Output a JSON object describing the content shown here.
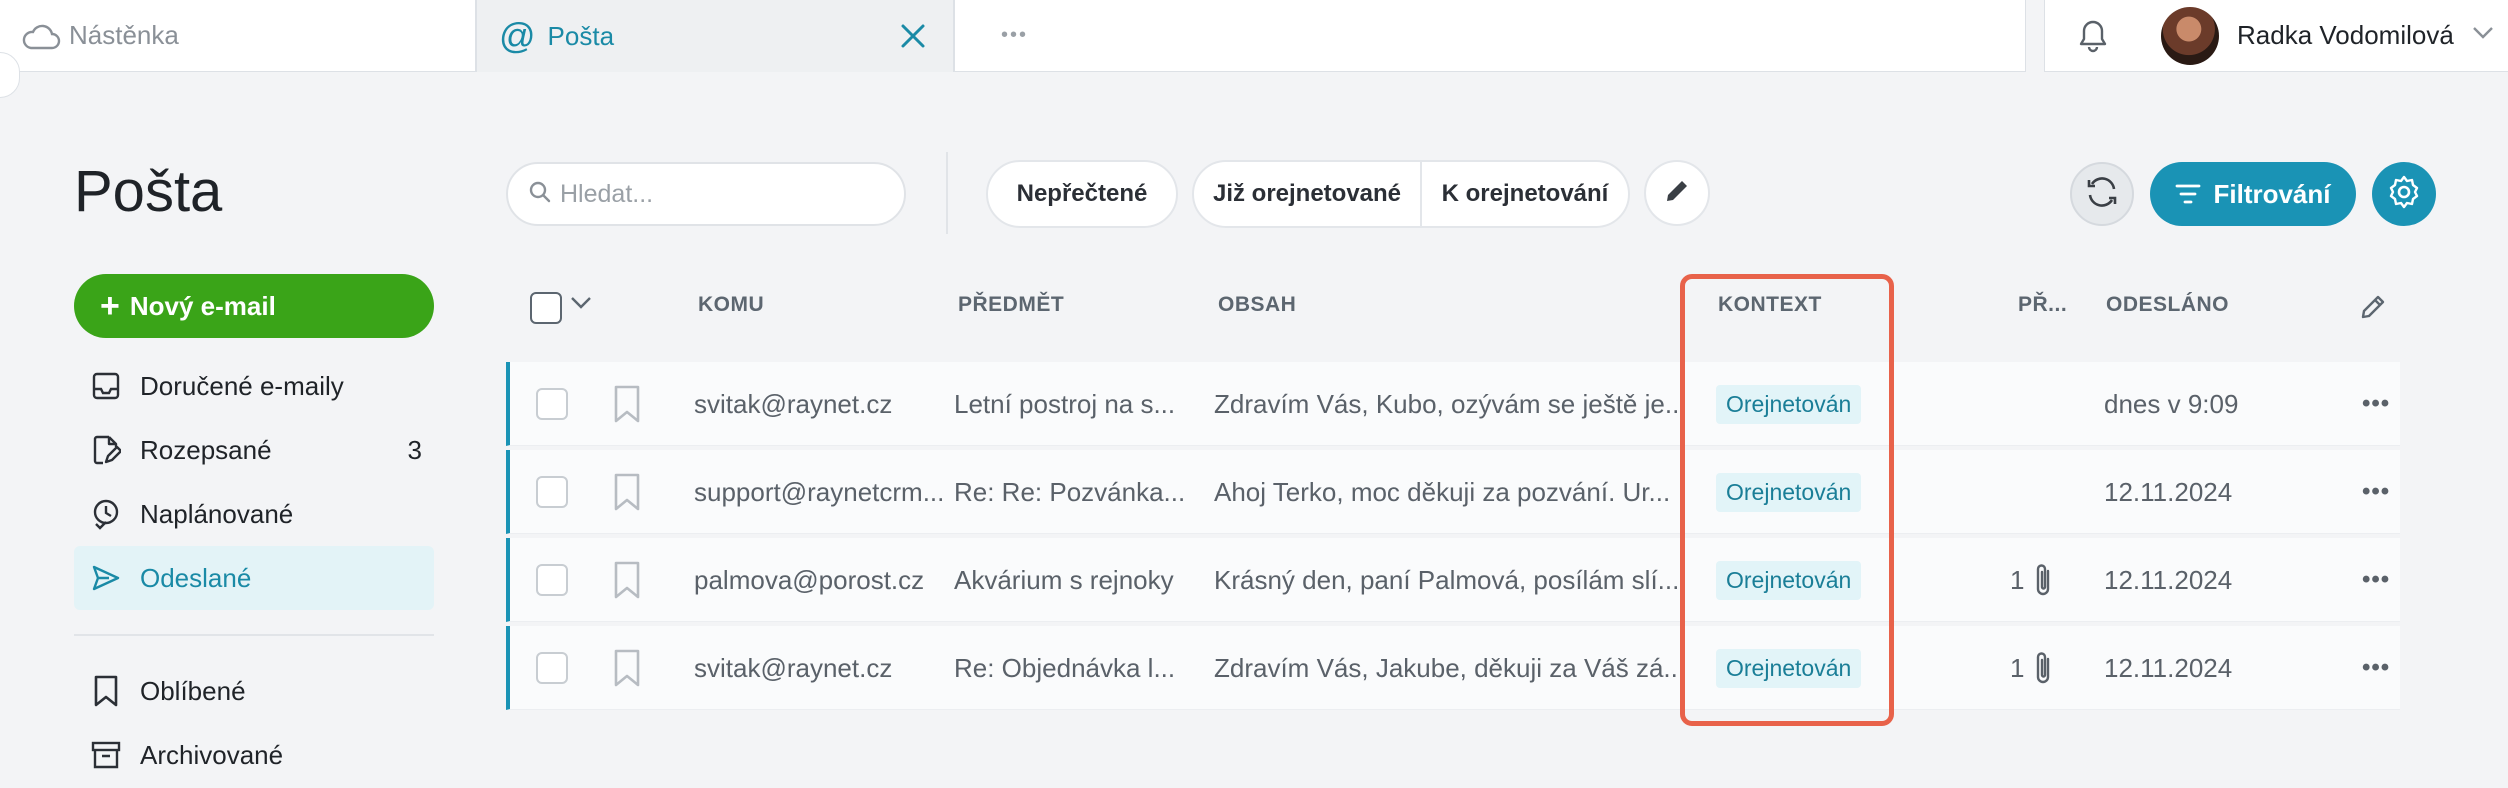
{
  "tabs": {
    "dashboard": "Nástěnka",
    "mail": "Pošta",
    "more": "•••"
  },
  "user": {
    "name": "Radka Vodomilová"
  },
  "page": {
    "title": "Pošta"
  },
  "sidebar": {
    "new_email": "Nový e-mail",
    "items": [
      {
        "label": "Doručené e-maily",
        "icon": "inbox-icon",
        "count": ""
      },
      {
        "label": "Rozepsané",
        "icon": "draft-icon",
        "count": "3"
      },
      {
        "label": "Naplánované",
        "icon": "scheduled-icon",
        "count": ""
      },
      {
        "label": "Odeslané",
        "icon": "send-icon",
        "count": "",
        "active": true
      },
      {
        "label": "Oblíbené",
        "icon": "bookmark-icon",
        "count": ""
      },
      {
        "label": "Archivované",
        "icon": "archive-icon",
        "count": ""
      }
    ]
  },
  "toolbar": {
    "search_placeholder": "Hledat...",
    "unread": "Nepřečtené",
    "already_tagged": "Již orejnetované",
    "to_tag": "K orejnetování",
    "filter": "Filtrování"
  },
  "table": {
    "headers": {
      "to": "KOMU",
      "subject": "PŘEDMĚT",
      "content": "OBSAH",
      "context": "KONTEXT",
      "attach": "PŘ...",
      "sent": "ODESLÁNO"
    },
    "rows": [
      {
        "to": "svitak@raynet.cz",
        "subject": "Letní postroj na s...",
        "content": "Zdravím Vás, Kubo, ozývám se ještě je...",
        "context": "Orejnetován",
        "attachments": "",
        "sent": "dnes v 9:09"
      },
      {
        "to": "support@raynetcrm...",
        "subject": "Re: Re: Pozvánka...",
        "content": "Ahoj Terko, moc děkuji za pozvání. Ur...",
        "context": "Orejnetován",
        "attachments": "",
        "sent": "12.11.2024"
      },
      {
        "to": "palmova@porost.cz",
        "subject": "Akvárium s rejnoky",
        "content": "Krásný den, paní Palmová, posílám slí...",
        "context": "Orejnetován",
        "attachments": "1",
        "sent": "12.11.2024"
      },
      {
        "to": "svitak@raynet.cz",
        "subject": "Re: Objednávka l...",
        "content": "Zdravím Vás, Jakube, děkuji za Váš zá...",
        "context": "Orejnetován",
        "attachments": "1",
        "sent": "12.11.2024"
      }
    ],
    "row_menu": "•••"
  },
  "colors": {
    "accent": "#1a93b5",
    "new_button": "#3aa418",
    "highlight": "#e8624a",
    "badge_bg": "#e2f4f8"
  }
}
